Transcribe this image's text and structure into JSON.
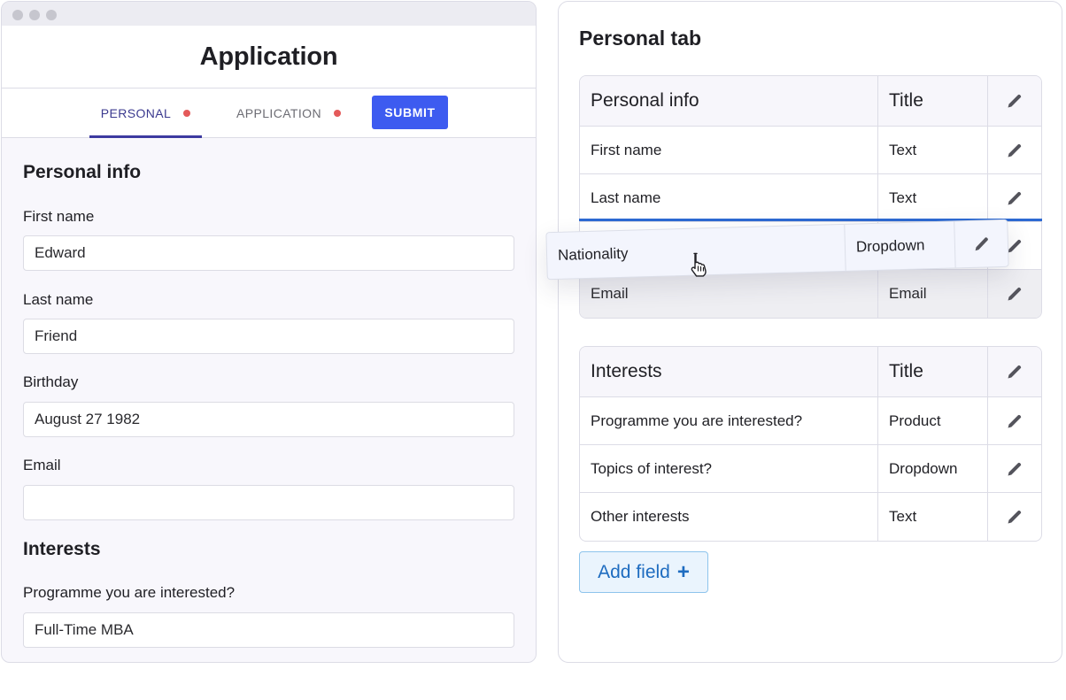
{
  "app": {
    "title": "Application",
    "tabs": [
      {
        "label": "PERSONAL",
        "active": true,
        "indicator_color": "#e45a5a"
      },
      {
        "label": "APPLICATION",
        "active": false,
        "indicator_color": "#e45a5a"
      }
    ],
    "submit_label": "SUBMIT"
  },
  "form": {
    "sections": [
      {
        "heading": "Personal info",
        "fields": [
          {
            "label": "First name",
            "value": "Edward"
          },
          {
            "label": "Last name",
            "value": "Friend"
          },
          {
            "label": "Birthday",
            "value": "August 27 1982"
          },
          {
            "label": "Email",
            "value": ""
          }
        ]
      },
      {
        "heading": "Interests",
        "fields": [
          {
            "label": "Programme you are interested?",
            "value": "Full-Time MBA"
          }
        ]
      }
    ]
  },
  "panel": {
    "title": "Personal tab",
    "tables": [
      {
        "header": {
          "name": "Personal info",
          "type": "Title"
        },
        "rows": [
          {
            "name": "First name",
            "type": "Text"
          },
          {
            "name": "Last name",
            "type": "Text"
          },
          {
            "name": "",
            "type": ""
          },
          {
            "name": "Email",
            "type": "Email"
          }
        ]
      },
      {
        "header": {
          "name": "Interests",
          "type": "Title"
        },
        "rows": [
          {
            "name": "Programme you are interested?",
            "type": "Product"
          },
          {
            "name": "Topics of interest?",
            "type": "Dropdown"
          },
          {
            "name": "Other interests",
            "type": "Text"
          }
        ]
      }
    ],
    "dragging": {
      "name": "Nationality",
      "type": "Dropdown"
    },
    "add_field_label": "Add field",
    "add_field_icon": "plus-icon"
  },
  "icons": {
    "edit": "pencil-icon",
    "cursor": "hand-cursor-icon"
  },
  "colors": {
    "accent": "#3d5bf0",
    "tab_active": "#3d3aa0",
    "indicator": "#e45a5a",
    "drop_line": "#2d6ad3",
    "add_field_text": "#1e6cc0"
  }
}
